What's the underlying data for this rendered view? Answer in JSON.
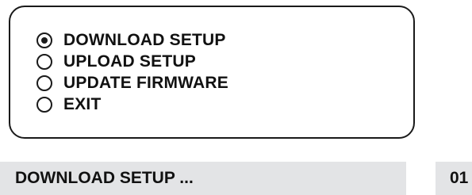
{
  "menu": {
    "options": [
      {
        "label": "DOWNLOAD SETUP",
        "selected": true
      },
      {
        "label": "UPLOAD SETUP",
        "selected": false
      },
      {
        "label": "UPDATE FIRMWARE",
        "selected": false
      },
      {
        "label": "EXIT",
        "selected": false
      }
    ]
  },
  "status": {
    "text": "DOWNLOAD SETUP ...",
    "counter": "01"
  }
}
